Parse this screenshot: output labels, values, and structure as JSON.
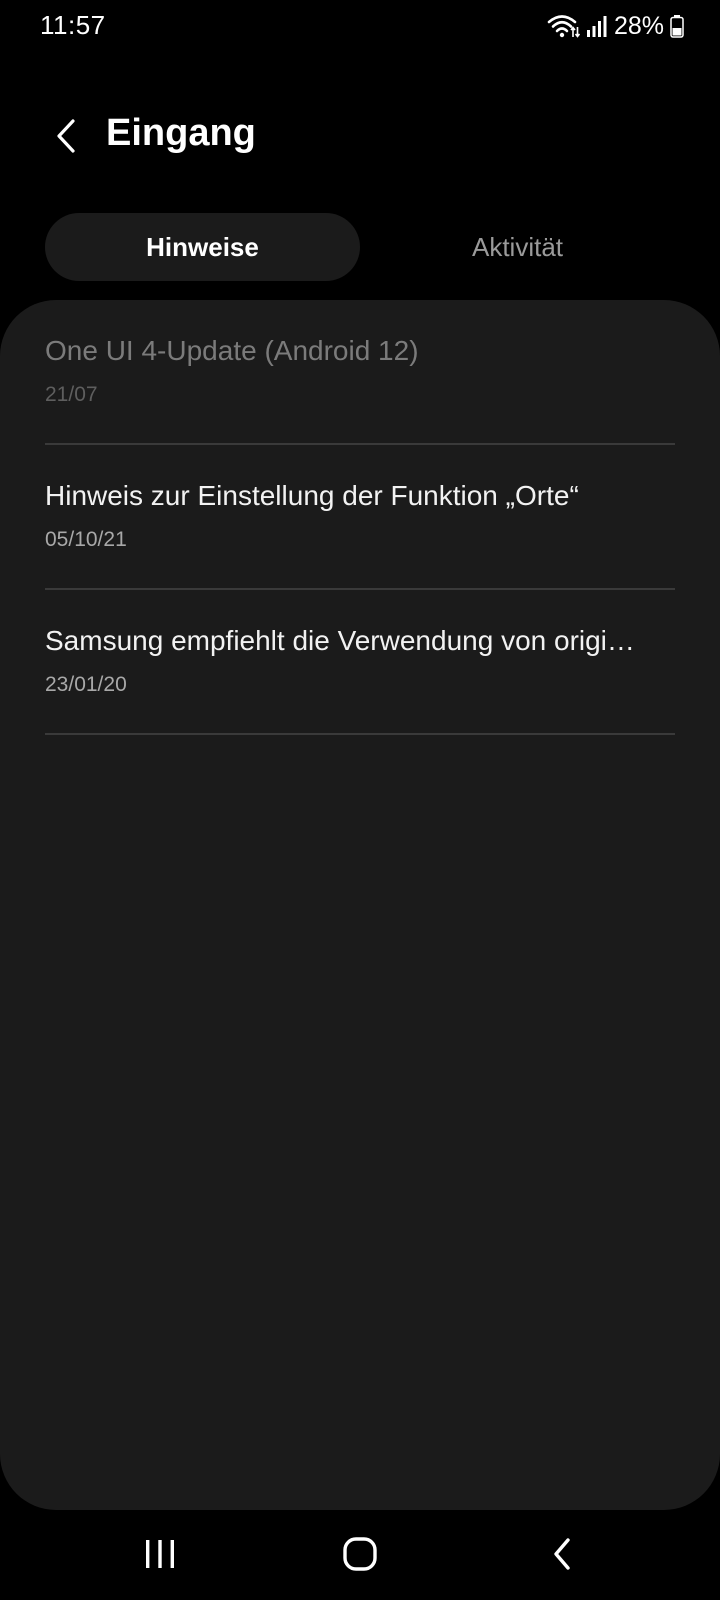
{
  "status_bar": {
    "time": "11:57",
    "battery": "28%",
    "icons": [
      "wifi-icon",
      "signal-icon",
      "battery-icon"
    ]
  },
  "header": {
    "title": "Eingang",
    "back_icon": "back-arrow-icon"
  },
  "tabs": [
    {
      "label": "Hinweise",
      "active": true
    },
    {
      "label": "Aktivität",
      "active": false
    }
  ],
  "notices": [
    {
      "title": "One UI 4-Update (Android 12)",
      "date": "21/07",
      "read": true
    },
    {
      "title": "Hinweis zur Einstellung der Funktion „Orte“",
      "date": "05/10/21",
      "read": false
    },
    {
      "title": "Samsung empfiehlt die Verwendung von origi…",
      "date": "23/01/20",
      "read": false
    }
  ],
  "nav_bar": {
    "icons": [
      "recents-icon",
      "home-icon",
      "back-icon"
    ]
  },
  "colors": {
    "background": "#000000",
    "card": "#1b1b1b",
    "divider": "#3a3a3a",
    "text_primary": "#f2f2f2",
    "text_read": "#7b7b7b"
  }
}
